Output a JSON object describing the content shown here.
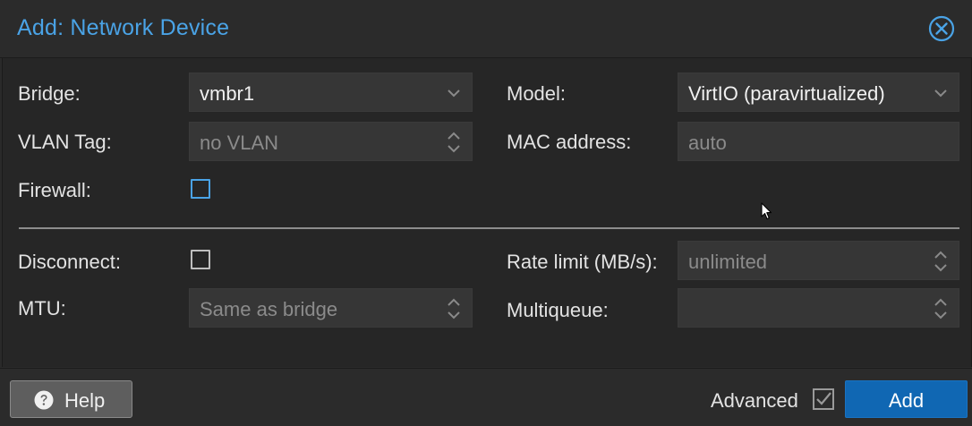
{
  "dialog": {
    "title": "Add: Network Device",
    "close_icon": "close-circle-icon",
    "accent_color": "#4aa3e6"
  },
  "form": {
    "bridge": {
      "label": "Bridge:",
      "value": "vmbr1"
    },
    "model": {
      "label": "Model:",
      "value": "VirtIO (paravirtualized)"
    },
    "vlan_tag": {
      "label": "VLAN Tag:",
      "placeholder": "no VLAN"
    },
    "mac_address": {
      "label": "MAC address:",
      "placeholder": "auto"
    },
    "firewall": {
      "label": "Firewall:",
      "checked": false
    },
    "disconnect": {
      "label": "Disconnect:",
      "checked": false
    },
    "rate_limit": {
      "label": "Rate limit (MB/s):",
      "placeholder": "unlimited"
    },
    "mtu": {
      "label": "MTU:",
      "placeholder": "Same as bridge"
    },
    "multiqueue": {
      "label": "Multiqueue:",
      "value": ""
    }
  },
  "footer": {
    "help_label": "Help",
    "help_icon": "question-circle-icon",
    "advanced_label": "Advanced",
    "advanced_checked": true,
    "add_label": "Add",
    "add_color": "#1067b3"
  }
}
